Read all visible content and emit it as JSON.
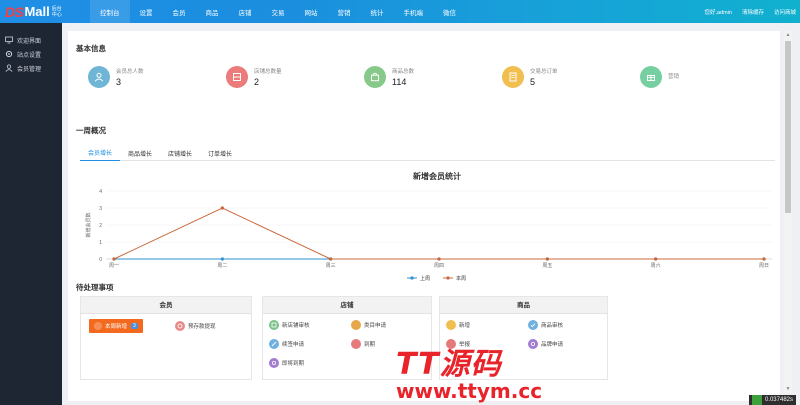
{
  "logo": {
    "brand": "DS",
    "product": "Mall",
    "sub": "后台中心"
  },
  "nav": {
    "items": [
      "控制台",
      "设置",
      "会员",
      "商品",
      "店铺",
      "交易",
      "网站",
      "营销",
      "统计",
      "手机端",
      "微信"
    ],
    "active": 0,
    "right": [
      "您好,admin",
      "清除缓存",
      "访问商城"
    ]
  },
  "sidebar": {
    "items": [
      {
        "label": "欢迎界面",
        "icon": "monitor-icon"
      },
      {
        "label": "站点设置",
        "icon": "gear-icon"
      },
      {
        "label": "会员管理",
        "icon": "user-icon"
      }
    ]
  },
  "basic_info": {
    "title": "基本信息",
    "stats": [
      {
        "label": "会员总人数",
        "value": "3",
        "color": "#6fb6d6",
        "icon": "user-icon"
      },
      {
        "label": "店铺总数量",
        "value": "2",
        "color": "#ec7b7b",
        "icon": "store-icon"
      },
      {
        "label": "商品总数",
        "value": "114",
        "color": "#86c98a",
        "icon": "bag-icon"
      },
      {
        "label": "交易总订单",
        "value": "5",
        "color": "#f1bf4f",
        "icon": "order-icon"
      },
      {
        "label": "营销",
        "value": "",
        "color": "#76cfa0",
        "icon": "gift-icon"
      }
    ]
  },
  "weekly": {
    "title": "一周概况",
    "tabs": [
      "会员增长",
      "商品增长",
      "店铺增长",
      "订单增长"
    ],
    "active_tab": 0
  },
  "chart_data": {
    "type": "line",
    "title": "新增会员统计",
    "ylabel": "新增会员数",
    "categories": [
      "周一",
      "周二",
      "周三",
      "周四",
      "周五",
      "周六",
      "周日"
    ],
    "ylim": [
      0,
      4
    ],
    "yticks": [
      0,
      1,
      2,
      3,
      4
    ],
    "series": [
      {
        "name": "上周",
        "color": "#2f8fcf",
        "values": [
          0,
          0,
          0,
          0,
          0,
          0,
          0
        ]
      },
      {
        "name": "本周",
        "color": "#c8683a",
        "values": [
          0,
          3,
          0,
          0,
          0,
          0,
          0
        ]
      }
    ],
    "legend": "bottom-center"
  },
  "pending": {
    "title": "待处理事项",
    "groups": [
      {
        "title": "会员",
        "items": [
          {
            "label": "本周新增",
            "badge": "3",
            "highlight": true,
            "color": "#f36a1e",
            "icon": "user-icon"
          },
          {
            "label": "预存款提现",
            "color": "#e88a8a",
            "icon": "wallet-icon"
          }
        ]
      },
      {
        "title": "店铺",
        "items": [
          {
            "label": "新店铺审核",
            "color": "#7cc08a",
            "icon": "store-icon"
          },
          {
            "label": "类目申请",
            "color": "#e7a64a",
            "icon": "list-icon"
          },
          {
            "label": "续签申请",
            "color": "#6fb0e0",
            "icon": "edit-icon"
          },
          {
            "label": "到期",
            "color": "#e67a7a",
            "icon": "clock-icon"
          },
          {
            "label": "即将到期",
            "color": "#a37bd0",
            "icon": "bell-icon"
          }
        ]
      },
      {
        "title": "商品",
        "items": [
          {
            "label": "新增",
            "color": "#f1bf4f",
            "icon": "plus-icon"
          },
          {
            "label": "商品审核",
            "color": "#6fb0e0",
            "icon": "check-icon"
          },
          {
            "label": "举报",
            "color": "#e67a7a",
            "icon": "flag-icon"
          },
          {
            "label": "品牌申请",
            "color": "#a37bd0",
            "icon": "tag-icon"
          }
        ]
      }
    ]
  },
  "watermark": {
    "top": "TT源码",
    "bottom": "www.ttym.cc"
  },
  "footer": {
    "timer": "0.037482s"
  }
}
